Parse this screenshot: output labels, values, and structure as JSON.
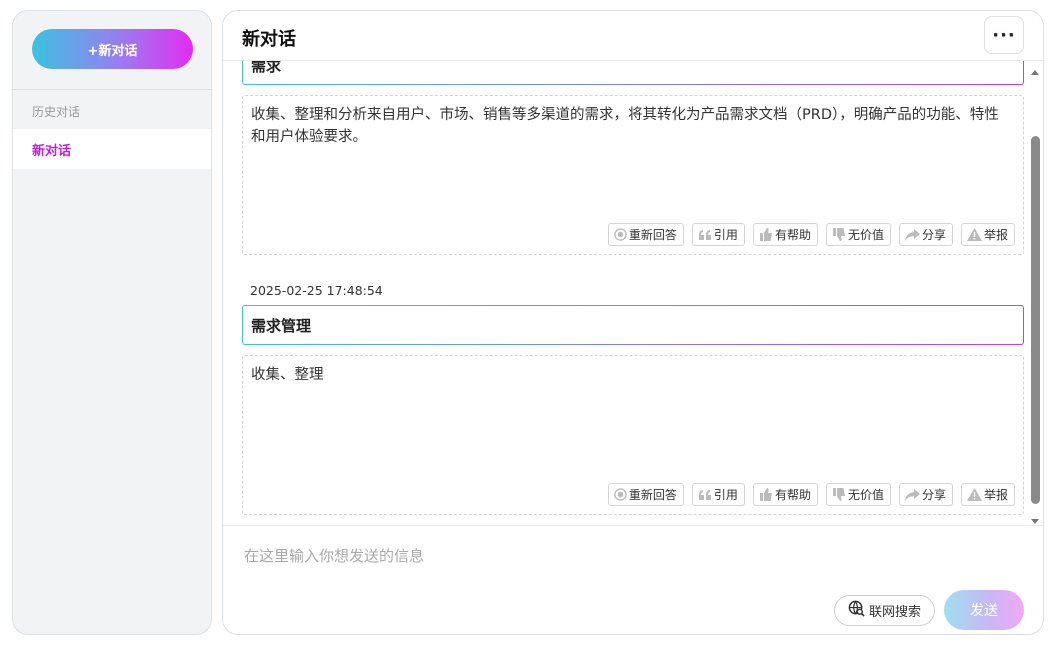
{
  "sidebar": {
    "new_chat_label": "+新对话",
    "history_label": "历史对话",
    "history_items": [
      {
        "label": "新对话"
      }
    ]
  },
  "header": {
    "title": "新对话",
    "more_label": "···"
  },
  "messages": [
    {
      "question": "需求",
      "answer": "收集、整理和分析来自用户、市场、销售等多渠道的需求，将其转化为产品需求文档（PRD），明确产品的功能、特性和用户体验要求。"
    },
    {
      "timestamp": "2025-02-25 17:48:54",
      "question": "需求管理",
      "answer": "收集、整理"
    }
  ],
  "actions": {
    "regenerate": "重新回答",
    "quote": "引用",
    "helpful": "有帮助",
    "not_helpful": "无价值",
    "share": "分享",
    "report": "举报"
  },
  "input": {
    "placeholder": "在这里输入你想发送的信息",
    "web_search_label": "联网搜索",
    "send_label": "发送"
  },
  "colors": {
    "accent_start": "#3cc2e0",
    "accent_end": "#e22cf2",
    "active_history": "#c020e8"
  }
}
